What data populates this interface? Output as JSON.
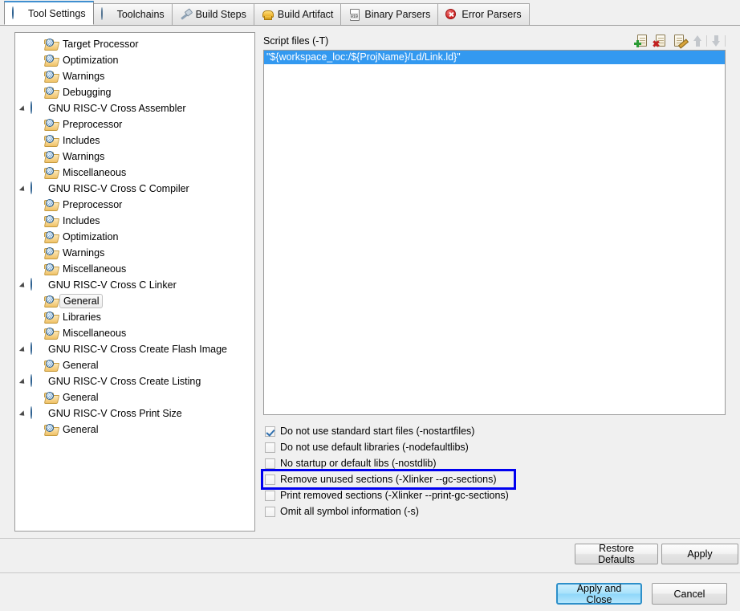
{
  "tabs": [
    {
      "label": "Tool Settings",
      "icon": "globe-icon",
      "selected": true
    },
    {
      "label": "Toolchains",
      "icon": "globe-icon",
      "selected": false
    },
    {
      "label": "Build Steps",
      "icon": "hammer-icon",
      "selected": false
    },
    {
      "label": "Build Artifact",
      "icon": "artifact-icon",
      "selected": false
    },
    {
      "label": "Binary Parsers",
      "icon": "binary-icon",
      "selected": false
    },
    {
      "label": "Error Parsers",
      "icon": "error-icon",
      "selected": false
    }
  ],
  "tree": [
    {
      "label": "Target Processor",
      "level": 1,
      "type": "leaf",
      "selected": false
    },
    {
      "label": "Optimization",
      "level": 1,
      "type": "leaf",
      "selected": false
    },
    {
      "label": "Warnings",
      "level": 1,
      "type": "leaf",
      "selected": false
    },
    {
      "label": "Debugging",
      "level": 1,
      "type": "leaf",
      "selected": false
    },
    {
      "label": "GNU RISC-V Cross Assembler",
      "level": 0,
      "type": "parent",
      "selected": false
    },
    {
      "label": "Preprocessor",
      "level": 1,
      "type": "leaf",
      "selected": false
    },
    {
      "label": "Includes",
      "level": 1,
      "type": "leaf",
      "selected": false
    },
    {
      "label": "Warnings",
      "level": 1,
      "type": "leaf",
      "selected": false
    },
    {
      "label": "Miscellaneous",
      "level": 1,
      "type": "leaf",
      "selected": false
    },
    {
      "label": "GNU RISC-V Cross C Compiler",
      "level": 0,
      "type": "parent",
      "selected": false
    },
    {
      "label": "Preprocessor",
      "level": 1,
      "type": "leaf",
      "selected": false
    },
    {
      "label": "Includes",
      "level": 1,
      "type": "leaf",
      "selected": false
    },
    {
      "label": "Optimization",
      "level": 1,
      "type": "leaf",
      "selected": false
    },
    {
      "label": "Warnings",
      "level": 1,
      "type": "leaf",
      "selected": false
    },
    {
      "label": "Miscellaneous",
      "level": 1,
      "type": "leaf",
      "selected": false
    },
    {
      "label": "GNU RISC-V Cross C Linker",
      "level": 0,
      "type": "parent",
      "selected": false
    },
    {
      "label": "General",
      "level": 1,
      "type": "leaf",
      "selected": true
    },
    {
      "label": "Libraries",
      "level": 1,
      "type": "leaf",
      "selected": false
    },
    {
      "label": "Miscellaneous",
      "level": 1,
      "type": "leaf",
      "selected": false
    },
    {
      "label": "GNU RISC-V Cross Create Flash Image",
      "level": 0,
      "type": "parent",
      "selected": false
    },
    {
      "label": "General",
      "level": 1,
      "type": "leaf",
      "selected": false
    },
    {
      "label": "GNU RISC-V Cross Create Listing",
      "level": 0,
      "type": "parent",
      "selected": false
    },
    {
      "label": "General",
      "level": 1,
      "type": "leaf",
      "selected": false
    },
    {
      "label": "GNU RISC-V Cross Print Size",
      "level": 0,
      "type": "parent",
      "selected": false
    },
    {
      "label": "General",
      "level": 1,
      "type": "leaf",
      "selected": false
    }
  ],
  "section": {
    "title": "Script files (-T)",
    "toolbar": [
      {
        "name": "add-script-file-icon",
        "tooltip": "Add"
      },
      {
        "name": "delete-script-file-icon",
        "tooltip": "Delete"
      },
      {
        "name": "edit-script-file-icon",
        "tooltip": "Edit"
      },
      {
        "name": "move-up-icon",
        "tooltip": "Move Up"
      },
      {
        "name": "move-down-icon",
        "tooltip": "Move Down"
      }
    ],
    "entries": [
      {
        "value": "\"${workspace_loc:/${ProjName}/Ld/Link.ld}\"",
        "selected": true
      }
    ]
  },
  "checkboxes": [
    {
      "label": "Do not use standard start files (-nostartfiles)",
      "checked": true,
      "annotated": false
    },
    {
      "label": "Do not use default libraries (-nodefaultlibs)",
      "checked": false,
      "annotated": false
    },
    {
      "label": "No startup or default libs (-nostdlib)",
      "checked": false,
      "annotated": false
    },
    {
      "label": "Remove unused sections (-Xlinker --gc-sections)",
      "checked": false,
      "annotated": true
    },
    {
      "label": "Print removed sections (-Xlinker --print-gc-sections)",
      "checked": false,
      "annotated": false
    },
    {
      "label": "Omit all symbol information (-s)",
      "checked": false,
      "annotated": false
    }
  ],
  "footer": {
    "restore_defaults": "Restore Defaults",
    "apply": "Apply",
    "apply_and_close": "Apply and Close",
    "cancel": "Cancel"
  },
  "colors": {
    "selection_blue": "#3399f0",
    "annotation_blue": "#0000f0",
    "default_button_border": "#2d8fc9",
    "dialog_background": "#f0f0f0"
  }
}
